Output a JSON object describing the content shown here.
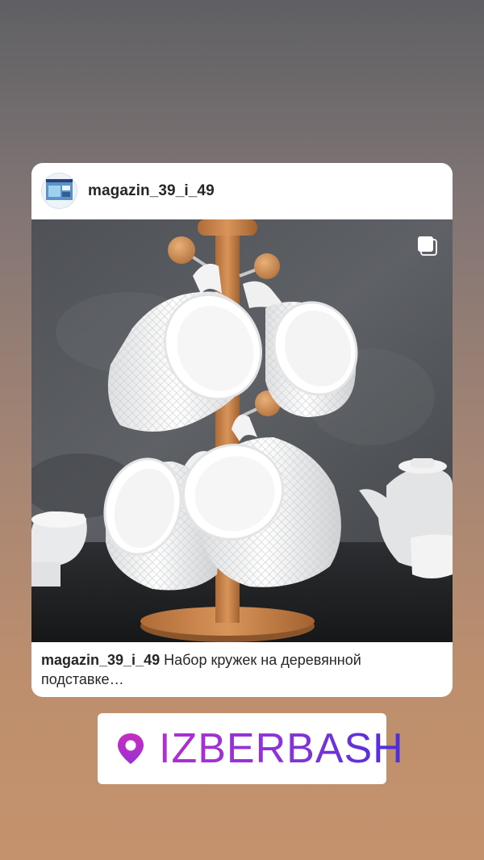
{
  "post": {
    "username": "magazin_39_i_49",
    "caption_username": "magazin_39_i_49",
    "caption_text": "Набор кружек на деревянной подставке…",
    "avatar_icon": "shop-avatar-icon",
    "multi_image_icon": "multiple-photos-icon"
  },
  "location_sticker": {
    "label": "IZBERBASH",
    "icon": "location-pin-icon",
    "gradient_colors": [
      "#b12fcf",
      "#4a2fdc"
    ]
  }
}
